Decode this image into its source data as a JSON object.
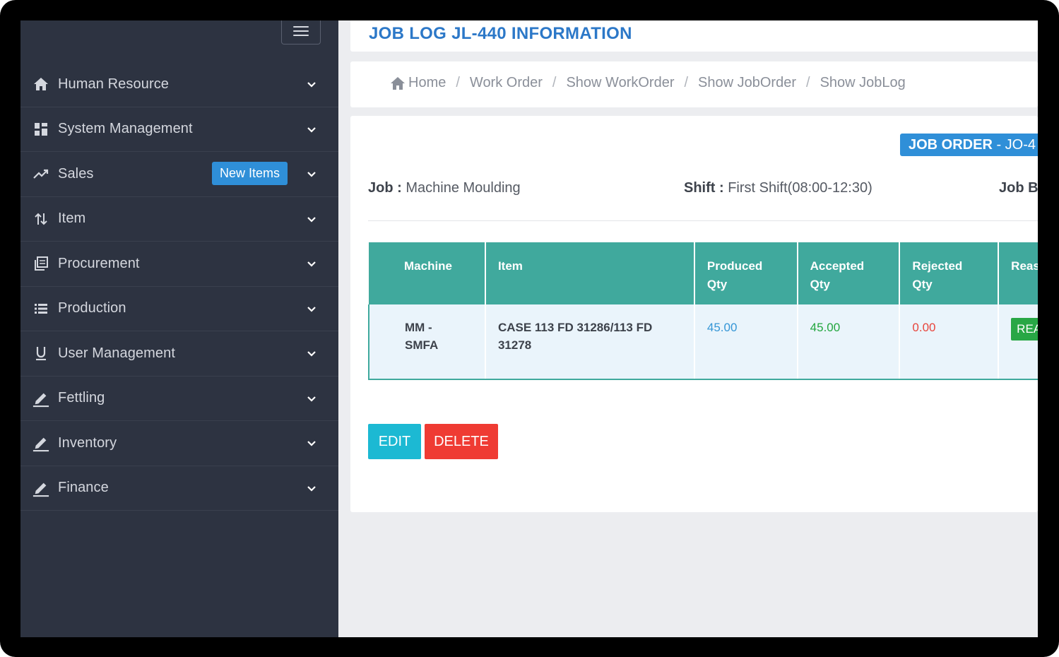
{
  "sidebar": {
    "items": [
      {
        "label": "Human Resource",
        "icon": "home-icon"
      },
      {
        "label": "System Management",
        "icon": "dashboard-icon"
      },
      {
        "label": "Sales",
        "icon": "trend-icon",
        "badge": "New Items"
      },
      {
        "label": "Item",
        "icon": "sort-icon"
      },
      {
        "label": "Procurement",
        "icon": "copy-icon"
      },
      {
        "label": "Production",
        "icon": "list-icon"
      },
      {
        "label": "User Management",
        "icon": "underline-icon"
      },
      {
        "label": "Fettling",
        "icon": "pencil-icon"
      },
      {
        "label": "Inventory",
        "icon": "pencil-icon"
      },
      {
        "label": "Finance",
        "icon": "pencil-icon"
      }
    ]
  },
  "header": {
    "title": "JOB LOG JL-440 INFORMATION"
  },
  "breadcrumb": {
    "items": [
      "Home",
      "Work Order",
      "Show WorkOrder",
      "Show JobOrder",
      "Show JobLog"
    ],
    "separator": "/"
  },
  "details": {
    "order_tag_prefix": "JOB ORDER",
    "order_tag_suffix": " - JO-4",
    "job_label": "Job :",
    "job_value": "Machine Moulding",
    "shift_label": "Shift :",
    "shift_value": "First Shift(08:00-12:30)",
    "job_b_label": "Job B"
  },
  "table": {
    "headers": [
      "Machine",
      "Item",
      "Produced Qty",
      "Accepted Qty",
      "Rejected Qty",
      "Reas"
    ],
    "rows": [
      {
        "machine": "MM - SMFA",
        "item": "CASE 113 FD 31286/113 FD 31278",
        "produced": "45.00",
        "accepted": "45.00",
        "rejected": "0.00",
        "reason": "REA"
      }
    ]
  },
  "actions": {
    "edit_label": "EDIT",
    "delete_label": "DELETE"
  },
  "colors": {
    "sidebar_bg": "#2d3341",
    "accent_blue": "#2f8fd8",
    "table_header": "#40a99d",
    "edit": "#1cb9d3",
    "delete": "#ef3b33"
  }
}
